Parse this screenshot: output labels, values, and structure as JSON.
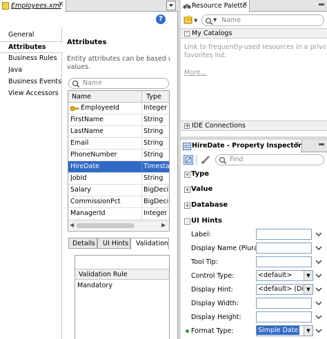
{
  "left_tab": {
    "title": "Employees.xml"
  },
  "nav": {
    "items": [
      "General",
      "Attributes",
      "Business Rules",
      "Java",
      "Business Events",
      "View Accessors"
    ],
    "selected": 1
  },
  "attributes": {
    "heading": "Attributes",
    "description_line1": "Entity attributes can be based upon",
    "description_line2": "values.",
    "search_placeholder": "Name",
    "columns": [
      "Name",
      "Type"
    ],
    "rows": [
      {
        "name": "EmployeeId",
        "type": "Integer",
        "key": true
      },
      {
        "name": "FirstName",
        "type": "String"
      },
      {
        "name": "LastName",
        "type": "String"
      },
      {
        "name": "Email",
        "type": "String"
      },
      {
        "name": "PhoneNumber",
        "type": "String"
      },
      {
        "name": "HireDate",
        "type": "Timestamp",
        "selected": true
      },
      {
        "name": "JobId",
        "type": "String"
      },
      {
        "name": "Salary",
        "type": "BigDecimal"
      },
      {
        "name": "CommissionPct",
        "type": "BigDecimal"
      },
      {
        "name": "ManagerId",
        "type": "Integer"
      }
    ]
  },
  "bottom_tabs": [
    "Details",
    "UI Hints",
    "Validation R"
  ],
  "validation": {
    "column": "Validation Rule",
    "rows": [
      "Mandatory"
    ]
  },
  "resource_palette": {
    "title": "Resource Palette",
    "search_placeholder": "Name",
    "my_catalogs": "My Catalogs",
    "hint_line1": "Link to frequently-used resources in a private",
    "hint_line2": "favorites list.",
    "more_link": "More...",
    "ide_connections": "IDE Connections"
  },
  "inspector": {
    "title": "HireDate - Property Inspector",
    "find_placeholder": "Find",
    "sections": [
      "Type",
      "Value",
      "Database",
      "UI Hints"
    ],
    "properties": [
      {
        "label": "Label:",
        "value": "",
        "kind": "text"
      },
      {
        "label": "Display Name (Plural):",
        "value": "",
        "kind": "text"
      },
      {
        "label": "Tool Tip:",
        "value": "",
        "kind": "text"
      },
      {
        "label": "Control Type:",
        "value": "<default>",
        "kind": "select"
      },
      {
        "label": "Display Hint:",
        "value": "<default> (Di...",
        "kind": "select"
      },
      {
        "label": "Display Width:",
        "value": "",
        "kind": "text"
      },
      {
        "label": "Display Height:",
        "value": "",
        "kind": "text"
      },
      {
        "label": "Format Type:",
        "value": "Simple Date",
        "kind": "select",
        "highlight": true
      }
    ]
  },
  "colors": {
    "selection": "#3169c6",
    "panel": "#eeeeee",
    "tab_active": "#ffffff",
    "border": "#a0a0a0"
  }
}
